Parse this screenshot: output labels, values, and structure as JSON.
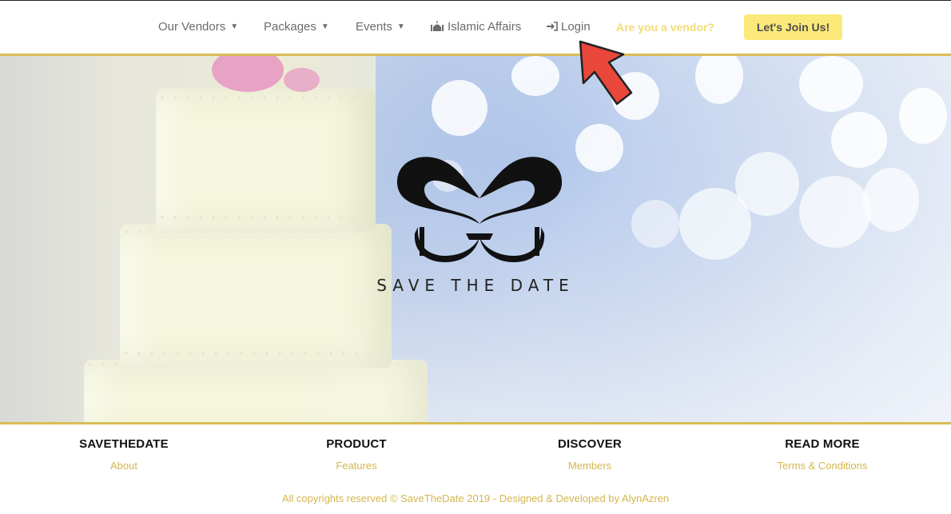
{
  "nav": {
    "our_vendors": "Our Vendors",
    "packages": "Packages",
    "events": "Events",
    "islamic_affairs": "Islamic Affairs",
    "login": "Login",
    "vendor_link": "Are you a vendor?",
    "join_button": "Let's Join Us!"
  },
  "icons": {
    "dropdown": "chevron-down-icon",
    "islamic_affairs": "mosque-icon",
    "login": "sign-in-icon",
    "annotation": "red-arrow-pointer"
  },
  "hero": {
    "brand_text": "SAVE THE DATE"
  },
  "footer": {
    "columns": [
      {
        "heading": "SAVETHEDATE",
        "link": "About"
      },
      {
        "heading": "PRODUCT",
        "link": "Features"
      },
      {
        "heading": "DISCOVER",
        "link": "Members"
      },
      {
        "heading": "READ MORE",
        "link": "Terms & Conditions"
      }
    ],
    "copyright": "All copyrights reserved © SaveTheDate 2019 - Designed & Developed by AlynAzren"
  },
  "colors": {
    "accent_gold": "#d9bd56",
    "link_gold": "#d4b64e",
    "vendor_yellow": "#f3dd74",
    "join_button_bg": "#fbea7a",
    "arrow_red": "#e8473a"
  }
}
